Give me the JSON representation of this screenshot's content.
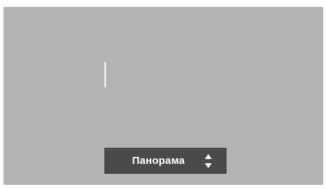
{
  "mode_selector": {
    "selected_label": "Панорама",
    "icon": "updown-arrows-icon"
  },
  "colors": {
    "background": "#b3b3b3",
    "selector_bg": "#4a4a4a",
    "text": "#ffffff"
  }
}
